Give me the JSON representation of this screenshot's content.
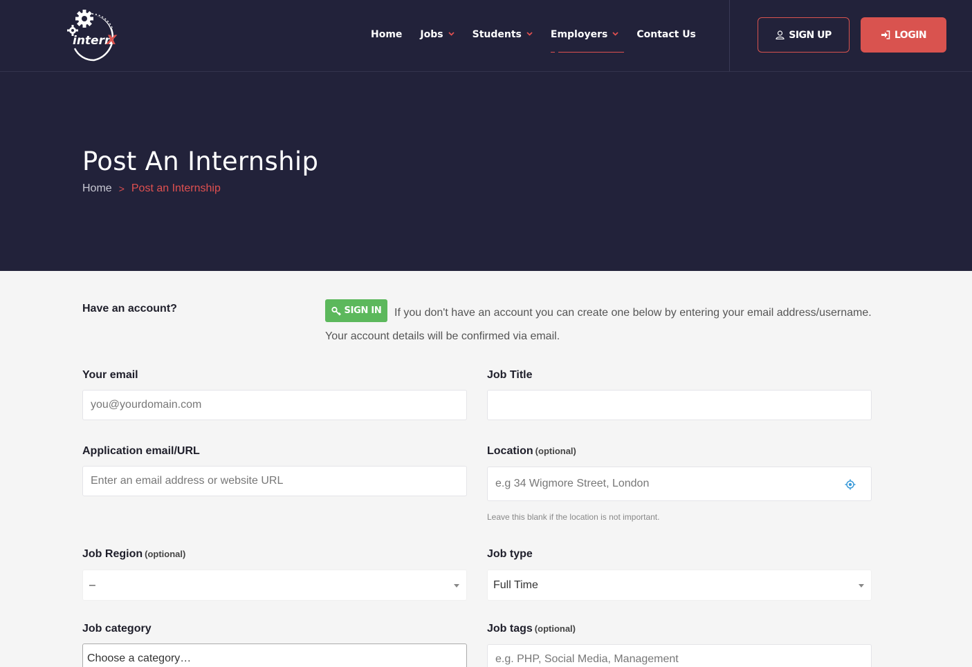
{
  "header": {
    "logo_text": "internX",
    "nav": [
      {
        "label": "Home",
        "has_dropdown": false,
        "active": false
      },
      {
        "label": "Jobs",
        "has_dropdown": true,
        "active": false
      },
      {
        "label": "Students",
        "has_dropdown": true,
        "active": false
      },
      {
        "label": "Employers",
        "has_dropdown": true,
        "active": true
      },
      {
        "label": "Contact Us",
        "has_dropdown": false,
        "active": false
      }
    ],
    "signup_label": "SIGN UP",
    "login_label": "LOGIN"
  },
  "hero": {
    "title": "Post An Internship",
    "breadcrumb": {
      "home": "Home",
      "separator": ">",
      "current": "Post an Internship"
    }
  },
  "account": {
    "label": "Have an account?",
    "signin_label": "SIGN IN",
    "text": "If you don't have an account you can create one below by entering your email address/username. Your account details will be confirmed via email."
  },
  "form": {
    "email": {
      "label": "Your email",
      "placeholder": "you@yourdomain.com"
    },
    "job_title": {
      "label": "Job Title",
      "value": ""
    },
    "application": {
      "label": "Application email/URL",
      "placeholder": "Enter an email address or website URL"
    },
    "location": {
      "label": "Location",
      "optional": "(optional)",
      "placeholder": "e.g 34 Wigmore Street, London",
      "helper": "Leave this blank if the location is not important."
    },
    "region": {
      "label": "Job Region",
      "optional": "(optional)",
      "value": "–"
    },
    "job_type": {
      "label": "Job type",
      "value": "Full Time"
    },
    "category": {
      "label": "Job category",
      "placeholder": "Choose a category…"
    },
    "tags": {
      "label": "Job tags",
      "optional": "(optional)",
      "placeholder": "e.g. PHP, Social Media, Management"
    }
  },
  "colors": {
    "header_bg": "#22223a",
    "accent": "#d9534f",
    "signin_green": "#5cb85c",
    "page_bg": "#f5f5f5"
  }
}
